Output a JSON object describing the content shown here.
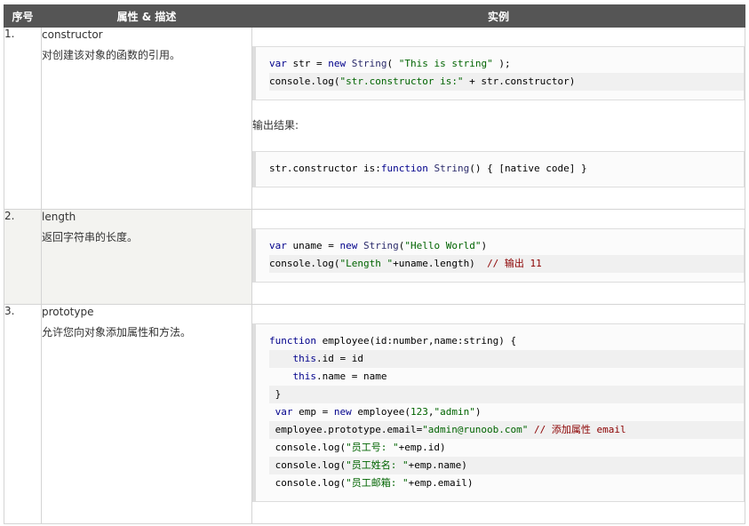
{
  "headers": {
    "index": "序号",
    "property": "属性 & 描述",
    "example": "实例"
  },
  "rows": [
    {
      "index": "1.",
      "property": "constructor",
      "description": "对创建该对象的函数的引用。",
      "output_label": "输出结果:",
      "code": [
        [
          {
            "t": "var ",
            "c": "kw"
          },
          {
            "t": "str",
            "c": ""
          },
          {
            "t": " = ",
            "c": ""
          },
          {
            "t": "new ",
            "c": "kw"
          },
          {
            "t": "String",
            "c": "fn"
          },
          {
            "t": "( ",
            "c": ""
          },
          {
            "t": "\"This is string\"",
            "c": "str"
          },
          {
            "t": " );",
            "c": ""
          }
        ],
        [
          {
            "t": "console.log(",
            "c": ""
          },
          {
            "t": "\"str.constructor is:\"",
            "c": "str"
          },
          {
            "t": " + str.constructor)",
            "c": ""
          }
        ]
      ],
      "output": [
        [
          {
            "t": "str.constructor is:",
            "c": ""
          },
          {
            "t": "function ",
            "c": "kw"
          },
          {
            "t": "String",
            "c": "fn"
          },
          {
            "t": "() { [native code] }",
            "c": ""
          }
        ]
      ]
    },
    {
      "index": "2.",
      "property": "length",
      "description": "返回字符串的长度。",
      "code": [
        [
          {
            "t": "var ",
            "c": "kw"
          },
          {
            "t": "uname = ",
            "c": ""
          },
          {
            "t": "new ",
            "c": "kw"
          },
          {
            "t": "String",
            "c": "fn"
          },
          {
            "t": "(",
            "c": ""
          },
          {
            "t": "\"Hello World\"",
            "c": "str"
          },
          {
            "t": ")",
            "c": ""
          }
        ],
        [
          {
            "t": "console.log(",
            "c": ""
          },
          {
            "t": "\"Length \"",
            "c": "str"
          },
          {
            "t": "+uname.length)  ",
            "c": ""
          },
          {
            "t": "// 输出 11",
            "c": "cm"
          }
        ]
      ]
    },
    {
      "index": "3.",
      "property": "prototype",
      "description": "允许您向对象添加属性和方法。",
      "code": [
        [
          {
            "t": "function ",
            "c": "kw"
          },
          {
            "t": "employee(id:number,name:string) {",
            "c": ""
          }
        ],
        [
          {
            "t": "    ",
            "c": ""
          },
          {
            "t": "this",
            "c": "kw"
          },
          {
            "t": ".id = id",
            "c": ""
          }
        ],
        [
          {
            "t": "    ",
            "c": ""
          },
          {
            "t": "this",
            "c": "kw"
          },
          {
            "t": ".name = name",
            "c": ""
          }
        ],
        [
          {
            "t": " }",
            "c": ""
          }
        ],
        [
          {
            "t": " ",
            "c": ""
          },
          {
            "t": "var ",
            "c": "kw"
          },
          {
            "t": "emp = ",
            "c": ""
          },
          {
            "t": "new ",
            "c": "kw"
          },
          {
            "t": "employee(",
            "c": ""
          },
          {
            "t": "123",
            "c": "str"
          },
          {
            "t": ",",
            "c": ""
          },
          {
            "t": "\"admin\"",
            "c": "str"
          },
          {
            "t": ")",
            "c": ""
          }
        ],
        [
          {
            "t": " employee.prototype.email=",
            "c": ""
          },
          {
            "t": "\"admin@runoob.com\"",
            "c": "str"
          },
          {
            "t": " ",
            "c": ""
          },
          {
            "t": "// 添加属性 email",
            "c": "cm"
          }
        ],
        [
          {
            "t": " console.log(",
            "c": ""
          },
          {
            "t": "\"员工号: \"",
            "c": "str"
          },
          {
            "t": "+emp.id)",
            "c": ""
          }
        ],
        [
          {
            "t": " console.log(",
            "c": ""
          },
          {
            "t": "\"员工姓名: \"",
            "c": "str"
          },
          {
            "t": "+emp.name)",
            "c": ""
          }
        ],
        [
          {
            "t": " console.log(",
            "c": ""
          },
          {
            "t": "\"员工邮箱: \"",
            "c": "str"
          },
          {
            "t": "+emp.email)",
            "c": ""
          }
        ]
      ]
    }
  ]
}
